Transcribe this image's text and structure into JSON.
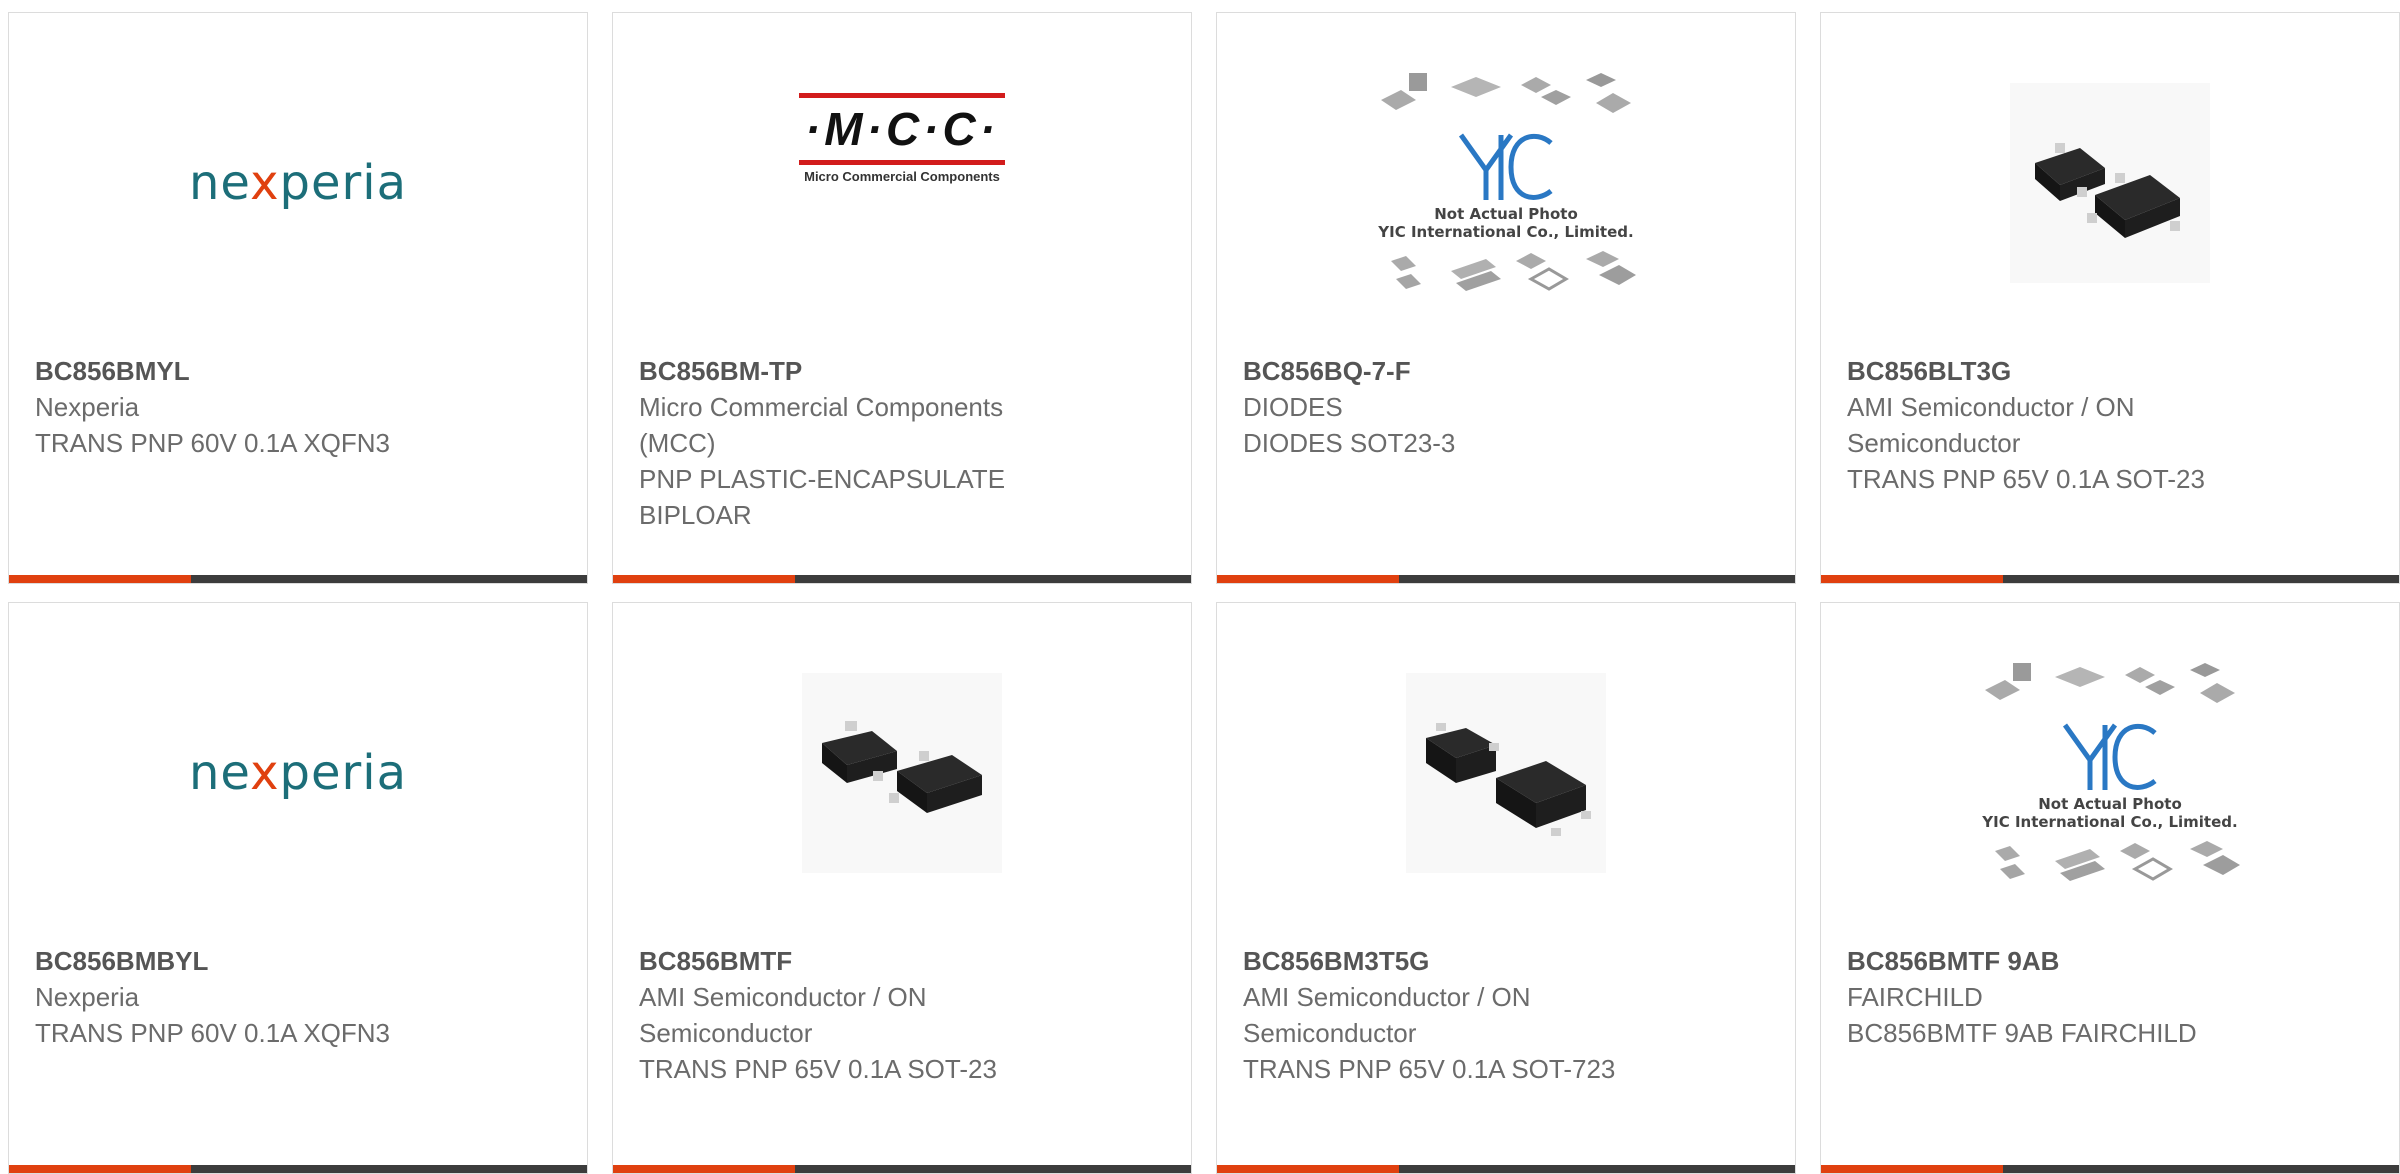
{
  "products": [
    {
      "part_number": "BC856BMYL",
      "manufacturer": "Nexperia",
      "description": "TRANS PNP 60V 0.1A XQFN3",
      "image": "nexperia-logo",
      "logo_text_pre": "ne",
      "logo_text_x": "x",
      "logo_text_post": "peria"
    },
    {
      "part_number": "BC856BM-TP",
      "manufacturer": "Micro Commercial Components (MCC)",
      "description": "PNP PLASTIC-ENCAPSULATE BIPLOAR",
      "image": "mcc-logo",
      "logo_text": "·M·C·C·",
      "logo_subtext": "Micro Commercial Components"
    },
    {
      "part_number": "BC856BQ-7-F",
      "manufacturer": "DIODES",
      "description": "DIODES SOT23-3",
      "image": "yic-placeholder",
      "placeholder_line1": "Not Actual Photo",
      "placeholder_line2": "YIC International Co., Limited."
    },
    {
      "part_number": "BC856BLT3G",
      "manufacturer": "AMI Semiconductor / ON Semiconductor",
      "description": "TRANS PNP 65V 0.1A SOT-23",
      "image": "sot23-photo"
    },
    {
      "part_number": "BC856BMBYL",
      "manufacturer": "Nexperia",
      "description": "TRANS PNP 60V 0.1A XQFN3",
      "image": "nexperia-logo",
      "logo_text_pre": "ne",
      "logo_text_x": "x",
      "logo_text_post": "peria"
    },
    {
      "part_number": "BC856BMTF",
      "manufacturer": "AMI Semiconductor / ON Semiconductor",
      "description": "TRANS PNP 65V 0.1A SOT-23",
      "image": "sot23-photo"
    },
    {
      "part_number": "BC856BM3T5G",
      "manufacturer": "AMI Semiconductor / ON Semiconductor",
      "description": "TRANS PNP 65V 0.1A SOT-723",
      "image": "sot723-photo"
    },
    {
      "part_number": "BC856BMTF 9AB",
      "manufacturer": "FAIRCHILD",
      "description": "BC856BMTF 9AB FAIRCHILD",
      "image": "yic-placeholder",
      "placeholder_line1": "Not Actual Photo",
      "placeholder_line2": "YIC International Co., Limited."
    }
  ],
  "colors": {
    "accent": "#e0400f",
    "bar_dark": "#3c3c3c",
    "text": "#6b6b6b",
    "nexperia_teal": "#1c6e79",
    "mcc_red": "#d21c1c"
  }
}
